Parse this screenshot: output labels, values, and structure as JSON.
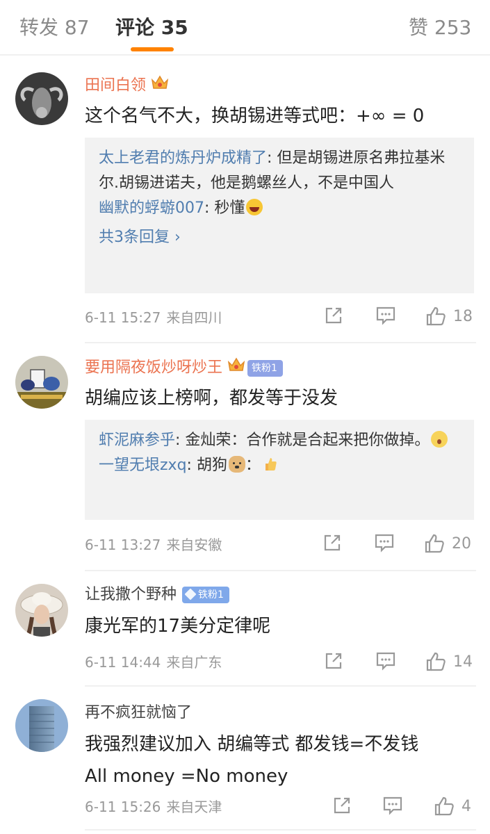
{
  "tabs": {
    "repost": "转发 87",
    "comments": "评论 35",
    "likes": "赞 253"
  },
  "comments": [
    {
      "username": "田间白领",
      "text": "这个名气不大，换胡锡进等式吧：+∞ = 0",
      "replies": [
        {
          "name": "太上老君的炼丹炉成精了",
          "text": ": 但是胡锡进原名弗拉基米尔.胡锡进诺夫，他是鹅螺丝人，不是中国人"
        },
        {
          "name": "幽默的蜉蝣007",
          "text": ": 秒懂"
        }
      ],
      "more_replies": "共3条回复",
      "time": "6-11 15:27",
      "source": "来自四川",
      "like_count": "18"
    },
    {
      "username": "要用隔夜饭炒呀炒王",
      "fan_badge": "铁粉1",
      "text": "胡编应该上榜啊，都发等于没发",
      "replies": [
        {
          "name": "虾泥麻参乎",
          "text": ": 金灿荣：合作就是合起来把你做掉。"
        },
        {
          "name": "一望无垠zxq",
          "text": ": 胡狗"
        }
      ],
      "time": "6-11 13:27",
      "source": "来自安徽",
      "like_count": "20"
    },
    {
      "username": "让我撒个野种",
      "fan_badge": "铁粉1",
      "text": "康光军的17美分定律呢",
      "time": "6-11 14:44",
      "source": "来自广东",
      "like_count": "14"
    },
    {
      "username": "再不疯狂就恼了",
      "text_line1": "我强烈建议加入 胡编等式 都发钱=不发钱",
      "text_line2": "All money =No money",
      "time": "6-11 15:26",
      "source": "来自天津",
      "like_count": "4"
    }
  ],
  "colors": {
    "accent": "#ff8200",
    "username_vip": "#eb7350",
    "reply_name": "#507daf"
  }
}
